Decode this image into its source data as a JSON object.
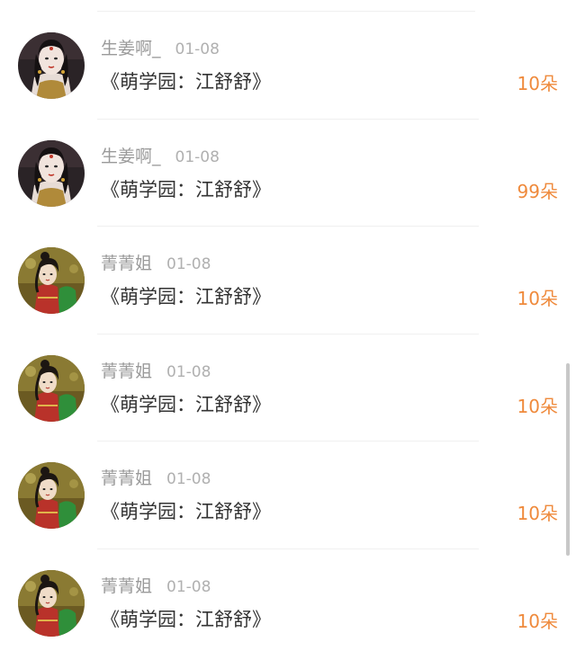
{
  "gift_list": {
    "items": [
      {
        "user": "生姜啊_",
        "date": "01-08",
        "title": "《萌学园：江舒舒》",
        "amount": "10朵",
        "avatar": "avatar-a"
      },
      {
        "user": "生姜啊_",
        "date": "01-08",
        "title": "《萌学园：江舒舒》",
        "amount": "99朵",
        "avatar": "avatar-a"
      },
      {
        "user": "菁菁姐",
        "date": "01-08",
        "title": "《萌学园：江舒舒》",
        "amount": "10朵",
        "avatar": "avatar-b"
      },
      {
        "user": "菁菁姐",
        "date": "01-08",
        "title": "《萌学园：江舒舒》",
        "amount": "10朵",
        "avatar": "avatar-b"
      },
      {
        "user": "菁菁姐",
        "date": "01-08",
        "title": "《萌学园：江舒舒》",
        "amount": "10朵",
        "avatar": "avatar-b"
      },
      {
        "user": "菁菁姐",
        "date": "01-08",
        "title": "《萌学园：江舒舒》",
        "amount": "10朵",
        "avatar": "avatar-b"
      }
    ]
  },
  "colors": {
    "amount": "#ef8a3c",
    "name": "#9a9a9a",
    "title": "#333333"
  }
}
